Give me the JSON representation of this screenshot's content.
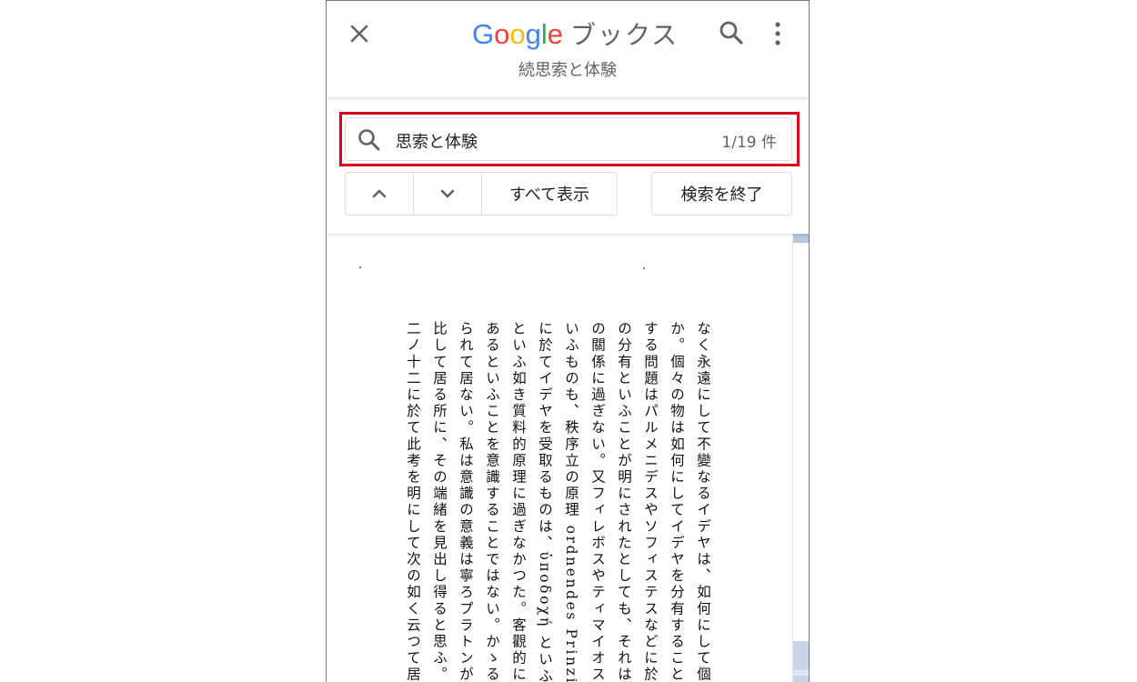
{
  "header": {
    "brand_letters": [
      {
        "ch": "G",
        "color": "#4285F4"
      },
      {
        "ch": "o",
        "color": "#EA4335"
      },
      {
        "ch": "o",
        "color": "#FBBC05"
      },
      {
        "ch": "g",
        "color": "#4285F4"
      },
      {
        "ch": "l",
        "color": "#34A853"
      },
      {
        "ch": "e",
        "color": "#EA4335"
      }
    ],
    "service_name": "ブックス",
    "book_title": "続思索と体験"
  },
  "find": {
    "query": "思索と体験",
    "result_count": "1/19 件",
    "show_all_label": "すべて表示",
    "end_search_label": "検索を終了"
  },
  "page": {
    "columns": [
      "なく永遠にして不變なるイデヤは、如何にして個々の物と結",
      "か。個々の物は如何にしてイデヤを分有することができる",
      "する問題はパルメニデスやソフィステスなどに於て論ぜら",
      "の分有といふことが明にされたとしても、それは客觀界に於",
      "の關係に過ぎない。又フィレボスやティマイオスに於て論",
      "いふものも、秩序立の原理 ordnendes Prinzip 以上に出て",
      "に於てイデヤを受取るものは、ὑποδοχή といふものと考へら",
      "といふ如き質料的原理に過ぎなかつた。客觀的に斯くある",
      "あるといふことを意識することではない。かゝる區別はま",
      "られて居ない。私は意識の意義は寧ろプラトンがテアイテ",
      "比して居る所に、その端緒を見出し得ると思ふ。アリストテ",
      "二ノ十二に於て此考を明にして次の如く云つて居る。In re"
    ]
  },
  "colors": {
    "highlight_border": "#e0001b",
    "icon_gray": "#5f6368"
  }
}
